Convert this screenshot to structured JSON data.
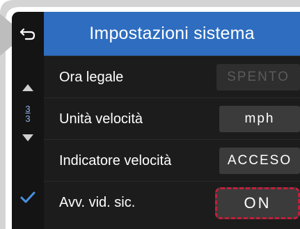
{
  "header": {
    "title": "Impostazioni sistema"
  },
  "pager": {
    "current": "3",
    "total": "3"
  },
  "settings": [
    {
      "label": "Ora legale",
      "value": "SPENTO",
      "state": "disabled"
    },
    {
      "label": "Unità velocità",
      "value": "mph",
      "state": "normal"
    },
    {
      "label": "Indicatore velocità",
      "value": "ACCESO",
      "state": "normal"
    },
    {
      "label": "Avv. vid. sic.",
      "value": "ON",
      "state": "highlighted"
    }
  ],
  "icons": {
    "back": "back-arrow-icon",
    "up": "arrow-up-icon",
    "down": "arrow-down-icon",
    "check": "checkmark-icon"
  },
  "colors": {
    "header": "#2e6dbf",
    "screen": "#1c1c1c",
    "accent_check": "#4a90e2",
    "highlight_border": "#c41e3a",
    "value_button": "#3b3b3b"
  }
}
